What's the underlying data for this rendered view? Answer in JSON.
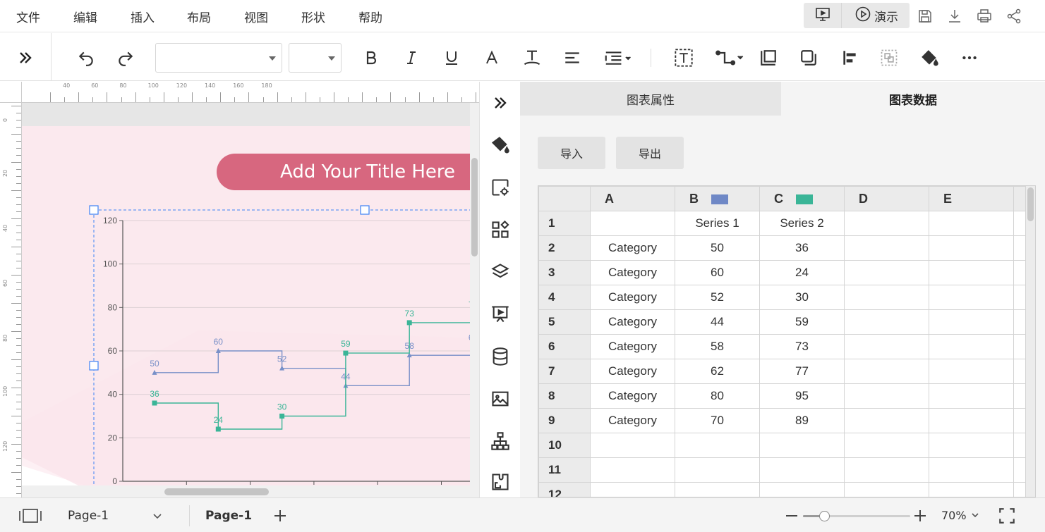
{
  "menu": {
    "items": [
      "文件",
      "编辑",
      "插入",
      "布局",
      "视图",
      "形状",
      "帮助"
    ],
    "present_label": "演示"
  },
  "toolbar": {
    "font_family_value": "",
    "font_size_value": "",
    "icons": [
      "expand-toolbar-icon",
      "undo-icon",
      "redo-icon",
      "bold-icon",
      "italic-icon",
      "underline-icon",
      "font-color-icon",
      "text-style-icon",
      "align-left-icon",
      "line-spacing-icon",
      "text-box-icon",
      "connector-icon",
      "bring-front-icon",
      "shadow-icon",
      "align-objects-icon",
      "group-icon",
      "fill-icon",
      "more-icon"
    ]
  },
  "ruler": {
    "top_labels": [
      "40",
      "60",
      "80",
      "100",
      "120",
      "140",
      "160",
      "180"
    ],
    "left_labels": [
      "0",
      "20",
      "40",
      "60",
      "80",
      "100",
      "120"
    ]
  },
  "canvas": {
    "title": "Add Your Title Here"
  },
  "chart_data": {
    "type": "line",
    "step": true,
    "categories": [
      "Category",
      "Category",
      "Category",
      "Category",
      "Category",
      "Category",
      "Category",
      "Category"
    ],
    "series": [
      {
        "name": "Series 1",
        "color": "#7890c8",
        "marker": "triangle",
        "values": [
          50,
          60,
          52,
          44,
          58,
          62,
          80,
          70
        ]
      },
      {
        "name": "Series 2",
        "color": "#3ab597",
        "marker": "square",
        "values": [
          36,
          24,
          30,
          59,
          73,
          77,
          95,
          89
        ]
      }
    ],
    "ylim": [
      0,
      120
    ],
    "yticks": [
      "0",
      "20",
      "40",
      "60",
      "80",
      "100",
      "120"
    ],
    "grid": true,
    "title": "",
    "xlabel": "",
    "ylabel": ""
  },
  "sidebar": {
    "icons": [
      "collapse-panel-icon",
      "fill-style-icon",
      "shape-settings-icon",
      "widgets-icon",
      "layers-icon",
      "presentation-icon",
      "database-icon",
      "image-icon",
      "org-chart-icon",
      "puzzle-icon"
    ]
  },
  "panel": {
    "tabs": [
      "图表属性",
      "图表数据"
    ],
    "active_tab": "图表数据",
    "import_label": "导入",
    "export_label": "导出",
    "columns": [
      "",
      "A",
      "B",
      "C",
      "D",
      "E"
    ],
    "column_swatches": {
      "B": "#6f88c6",
      "C": "#3ab597"
    },
    "rows": [
      [
        "1",
        "",
        "Series 1",
        "Series 2",
        "",
        ""
      ],
      [
        "2",
        "Category",
        "50",
        "36",
        "",
        ""
      ],
      [
        "3",
        "Category",
        "60",
        "24",
        "",
        ""
      ],
      [
        "4",
        "Category",
        "52",
        "30",
        "",
        ""
      ],
      [
        "5",
        "Category",
        "44",
        "59",
        "",
        ""
      ],
      [
        "6",
        "Category",
        "58",
        "73",
        "",
        ""
      ],
      [
        "7",
        "Category",
        "62",
        "77",
        "",
        ""
      ],
      [
        "8",
        "Category",
        "80",
        "95",
        "",
        ""
      ],
      [
        "9",
        "Category",
        "70",
        "89",
        "",
        ""
      ],
      [
        "10",
        "",
        "",
        "",
        "",
        ""
      ],
      [
        "11",
        "",
        "",
        "",
        "",
        ""
      ],
      [
        "12",
        "",
        "",
        "",
        "",
        ""
      ]
    ]
  },
  "statusbar": {
    "page_select": "Page-1",
    "page_tab": "Page-1",
    "zoom": "70%",
    "zoom_level": 0.2
  },
  "colors": {
    "accent": "#d7677f",
    "canvas_bg": "#fbe9ee",
    "selection": "#3b82f6"
  }
}
